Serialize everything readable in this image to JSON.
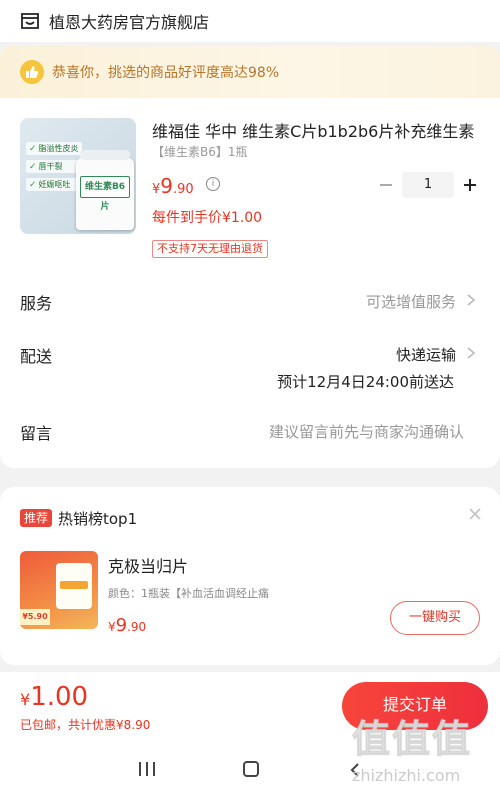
{
  "store": {
    "name": "植恩大药房官方旗舰店",
    "icon": "store-icon"
  },
  "banner": {
    "text": "恭喜你，挑选的商品好评度高达98%",
    "icon": "thumbs-up-icon",
    "color": "#b8752a"
  },
  "product": {
    "title": "维福佳 华中 维生素C片b1b2b6片补充维生素",
    "spec": "【维生素B6】1瓶",
    "thumb_tags": [
      "脂溢性皮炎",
      "唇干裂",
      "妊娠呕吐"
    ],
    "thumb_label": "维生素B6片",
    "price_symbol": "¥",
    "price_int": "9",
    "price_dec": ".90",
    "unit_price": "每件到手价¥1.00",
    "return_policy": "不支持7天无理由退货",
    "quantity": "1"
  },
  "rows": {
    "service_label": "服务",
    "service_value": "可选增值服务",
    "delivery_label": "配送",
    "delivery_value": "快递运输",
    "delivery_eta": "预计12月4日24:00前送达",
    "message_label": "留言",
    "message_placeholder": "建议留言前先与商家沟通确认"
  },
  "recommendation": {
    "badge": "推荐",
    "title": "热销榜top1",
    "name": "克极当归片",
    "spec": "颜色：1瓶装【补血活血调经止痛",
    "price_symbol": "¥",
    "price_int": "9",
    "price_dec": ".90",
    "thumb_price": "¥5.90",
    "buy_label": "一键购买"
  },
  "footer": {
    "total_symbol": "¥",
    "total_value": "1.00",
    "note": "已包邮，共计优惠¥8.90",
    "submit_label": "提交订单"
  },
  "watermark": {
    "logo": "值值值",
    "url": "zhizhizhi.com"
  },
  "colors": {
    "accent": "#e93323",
    "submit": "#f03a3c",
    "banner_bg": "#fbf1d9"
  }
}
